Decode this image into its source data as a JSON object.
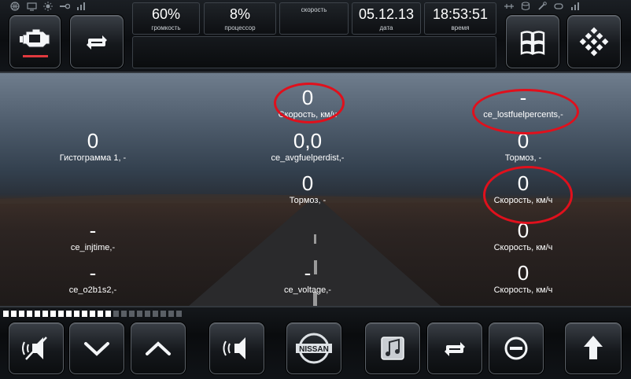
{
  "tray_icons": [
    "globe-icon",
    "monitor-icon",
    "sun-icon",
    "wrench-icon",
    "signal-icon",
    "antenna-icon",
    "database-icon",
    "wrench-alt-icon",
    "loop-icon",
    "signal-alt-icon"
  ],
  "stats": [
    {
      "value": "60%",
      "label": "громкость"
    },
    {
      "value": "8%",
      "label": "процессор"
    },
    {
      "value": "",
      "label": "скорость"
    },
    {
      "value": "05.12.13",
      "label": "дата"
    },
    {
      "value": "18:53:51",
      "label": "время"
    }
  ],
  "gauges": [
    {
      "value": "0",
      "label": "Скорость, км/ч"
    },
    {
      "value": "-",
      "label": "ce_lostfuelpercents,-"
    },
    {
      "value": "0",
      "label": "Гистограмма 1, -"
    },
    {
      "value": "0,0",
      "label": "ce_avgfuelperdist,-"
    },
    {
      "value": "0",
      "label": "Тормоз, -"
    },
    {
      "value": "0",
      "label": "Тормоз, -"
    },
    {
      "value": "0",
      "label": "Скорость, км/ч"
    },
    {
      "value": "-",
      "label": "ce_injtime,-"
    },
    {
      "value": "0",
      "label": "Скорость, км/ч"
    },
    {
      "value": "-",
      "label": "ce_o2b1s2,-"
    },
    {
      "value": "-",
      "label": "ce_voltage,-"
    },
    {
      "value": "0",
      "label": "Скорость, км/ч"
    }
  ],
  "colors": {
    "highlight_ring": "#e0101c",
    "active_indicator": "#e0393e",
    "level_on": "#ffffff",
    "level_off": "#5a5f65"
  },
  "volume_level_fraction": 0.6,
  "logo_text": "NISSAN"
}
